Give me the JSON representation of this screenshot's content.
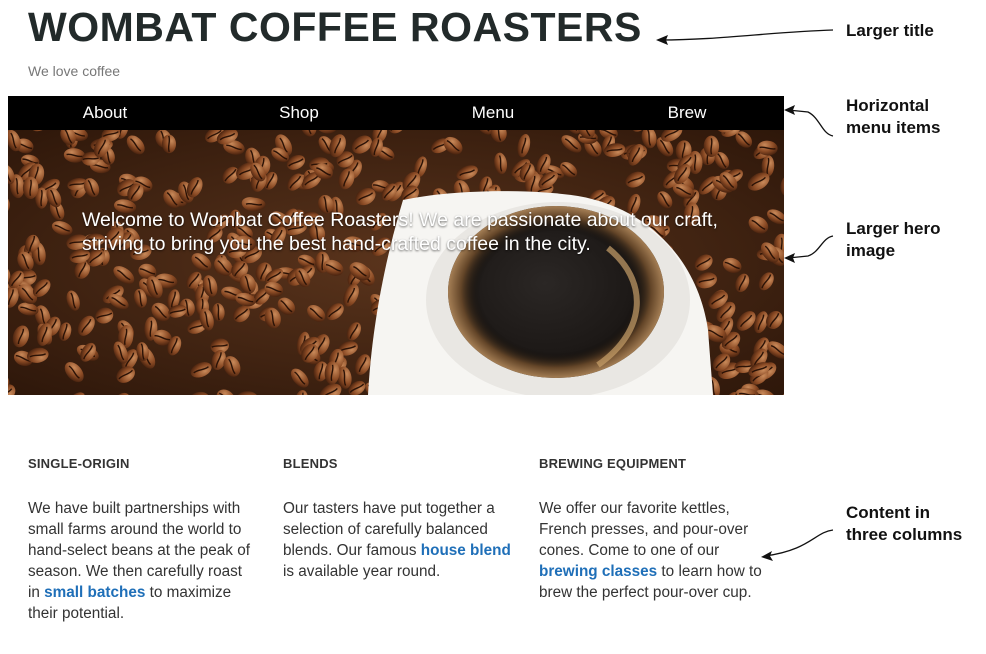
{
  "header": {
    "title": "WOMBAT COFFEE ROASTERS",
    "tagline": "We love coffee"
  },
  "nav": {
    "items": [
      {
        "label": "About"
      },
      {
        "label": "Shop"
      },
      {
        "label": "Menu"
      },
      {
        "label": "Brew"
      }
    ]
  },
  "hero": {
    "text": "Welcome to Wombat Coffee Roasters! We are passionate about our craft, striving to bring you the best hand-crafted coffee in the city."
  },
  "columns": [
    {
      "heading": "SINGLE-ORIGIN",
      "text_before": "We have built partnerships with small farms around the world to hand-select beans at the peak of season. We then carefully roast in ",
      "link": "small batches",
      "text_after": " to maximize their potential."
    },
    {
      "heading": "BLENDS",
      "text_before": "Our tasters have put together a selection of carefully balanced blends. Our famous ",
      "link": "house blend",
      "text_after": " is available year round."
    },
    {
      "heading": "BREWING EQUIPMENT",
      "text_before": "We offer our favorite kettles, French presses, and pour-over cones. Come to one of our ",
      "link": "brewing classes",
      "text_after": " to learn how to brew the perfect pour-over cup."
    }
  ],
  "annotations": {
    "title": "Larger title",
    "menu_line1": "Horizontal",
    "menu_line2": "menu items",
    "hero_line1": "Larger hero",
    "hero_line2": "image",
    "content_line1": "Content in",
    "content_line2": "three columns"
  },
  "colors": {
    "link": "#1f6fb8",
    "nav_bg": "#000000",
    "title": "#222a2a"
  }
}
